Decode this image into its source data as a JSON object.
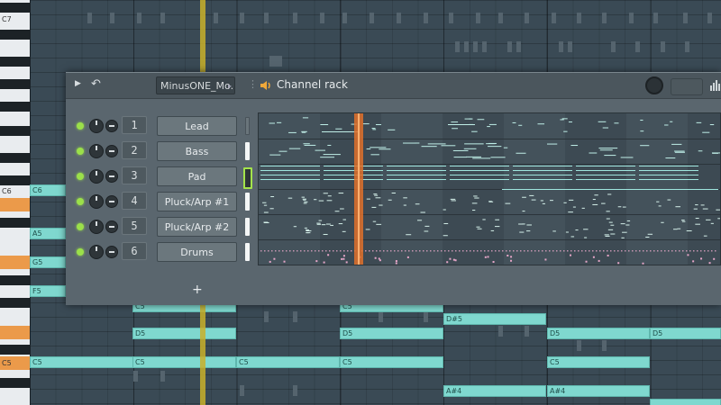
{
  "piano_roll": {
    "key_labels": [
      {
        "text": "C7",
        "key": "c7"
      },
      {
        "text": "C6",
        "key": "c6"
      },
      {
        "text": "C5",
        "key": "c5"
      }
    ],
    "notes": [
      {
        "label": "C6",
        "row": "r6"
      },
      {
        "label": "A5",
        "row": "r9"
      },
      {
        "label": "G5",
        "row": "r11"
      },
      {
        "label": "F5",
        "row": "r13"
      },
      {
        "label": "C5",
        "row": "r20a"
      },
      {
        "label": "C5",
        "row": "r20b"
      },
      {
        "label": "D#5",
        "row": "r21"
      },
      {
        "label": "D5",
        "row": "r22a"
      },
      {
        "label": "D5",
        "row": "r22b"
      },
      {
        "label": "D5",
        "row": "r22c"
      },
      {
        "label": "D5",
        "row": "r22d"
      },
      {
        "label": "C5",
        "row": "r24a"
      },
      {
        "label": "C5",
        "row": "r24b"
      },
      {
        "label": "C5",
        "row": "r24c"
      },
      {
        "label": "C5",
        "row": "r24d"
      },
      {
        "label": "C5",
        "row": "r24e"
      },
      {
        "label": "A#4",
        "row": "r26a"
      },
      {
        "label": "A#4",
        "row": "r26b"
      }
    ]
  },
  "channel_rack": {
    "title": "Channel rack",
    "preset_name": "MinusONE_Mo..",
    "add_button": "+",
    "channels": [
      {
        "number": "1",
        "name": "Lead"
      },
      {
        "number": "2",
        "name": "Bass"
      },
      {
        "number": "3",
        "name": "Pad"
      },
      {
        "number": "4",
        "name": "Pluck/Arp #1"
      },
      {
        "number": "5",
        "name": "Pluck/Arp #2"
      },
      {
        "number": "6",
        "name": "Drums"
      }
    ],
    "colors": {
      "led": "#9be04a",
      "note": "#7fd8cf",
      "playhead": "#e0702a",
      "drum_hits": "#e6a6c8"
    }
  }
}
